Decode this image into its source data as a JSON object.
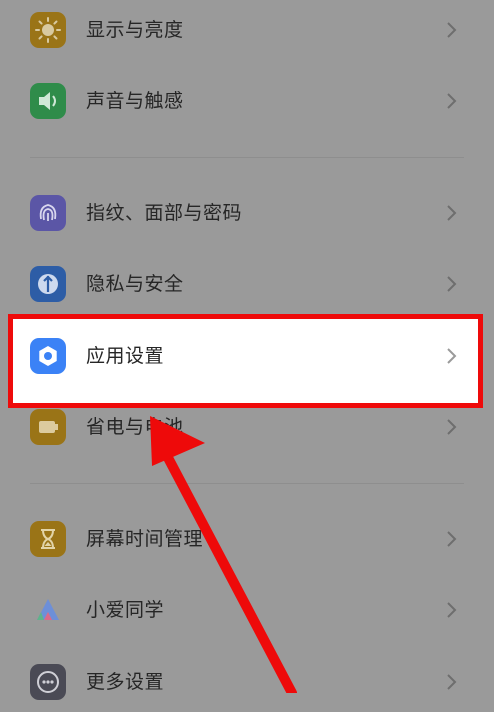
{
  "settings": {
    "group1": [
      {
        "label": "显示与亮度",
        "icon": "sun-icon",
        "color": "#9a7417"
      },
      {
        "label": "声音与触感",
        "icon": "speaker-icon",
        "color": "#2f8c4a"
      }
    ],
    "group2": [
      {
        "label": "指纹、面部与密码",
        "icon": "fingerprint-icon",
        "color": "#5b56a6"
      },
      {
        "label": "隐私与安全",
        "icon": "privacy-icon",
        "color": "#2d5da6"
      },
      {
        "label": "应用设置",
        "icon": "app-settings-icon",
        "color": "#3b82f6"
      },
      {
        "label": "省电与电池",
        "icon": "battery-icon",
        "color": "#9a7417"
      }
    ],
    "group3": [
      {
        "label": "屏幕时间管理",
        "icon": "hourglass-icon",
        "color": "#9a7417"
      },
      {
        "label": "小爱同学",
        "icon": "xiaoai-icon",
        "color": "#ffffff"
      },
      {
        "label": "更多设置",
        "icon": "more-icon",
        "color": "#4a4a55"
      }
    ]
  },
  "annotation": {
    "highlight_color": "#ee0a0a",
    "arrow_color": "#ee0a0a"
  }
}
